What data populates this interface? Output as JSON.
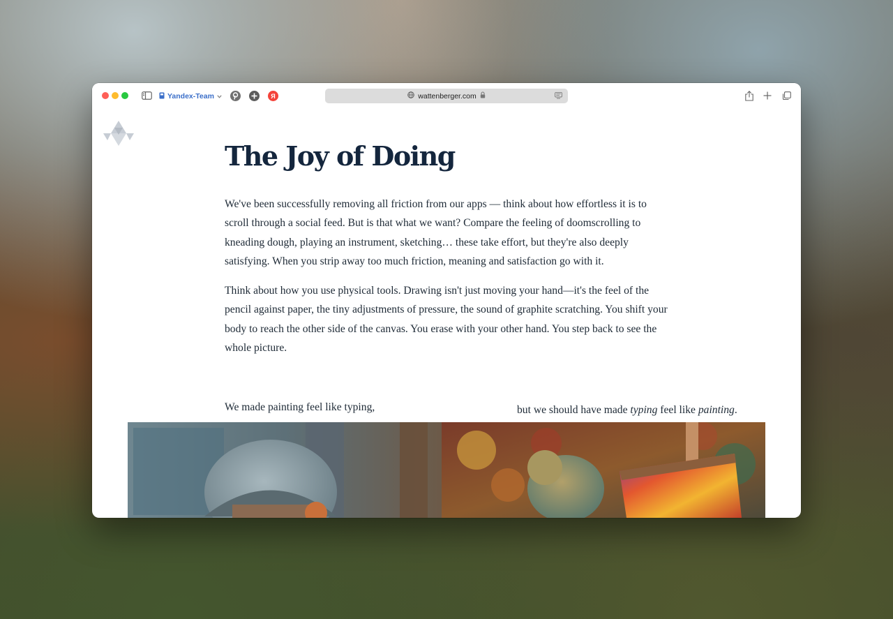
{
  "browser": {
    "profile_label": "Yandex-Team",
    "url": "wattenberger.com",
    "extensions": [
      "pinterest-icon",
      "plus-circle-icon",
      "yandex-icon"
    ],
    "extension_yandex_letter": "Я",
    "colors": {
      "profile": "#3b6fc9",
      "address_bg": "#dcdcdc"
    }
  },
  "article": {
    "title": "The Joy of Doing",
    "paragraphs": [
      "We've been successfully removing all friction from our apps — think about how effortless it is to scroll through a social feed. But is that what we want? Compare the feeling of doomscrolling to kneading dough, playing an instrument, sketching… these take effort, but they're also deeply satisfying. When you strip away too much friction, meaning and satisfaction go with it.",
      "Think about how you use physical tools. Drawing isn't just moving your hand—it's the feel of the pencil against paper, the tiny adjustments of pressure, the sound of graphite scratching. You shift your body to reach the other side of the canvas. You erase with your other hand. You step back to see the whole picture."
    ],
    "caption_left": "We made painting feel like typing,",
    "caption_right": {
      "before": "but we should have made ",
      "em1": "typing",
      "middle": " feel like ",
      "em2": "painting",
      "after": "."
    },
    "title_color": "#14263d",
    "text_color": "#1e2a36"
  }
}
